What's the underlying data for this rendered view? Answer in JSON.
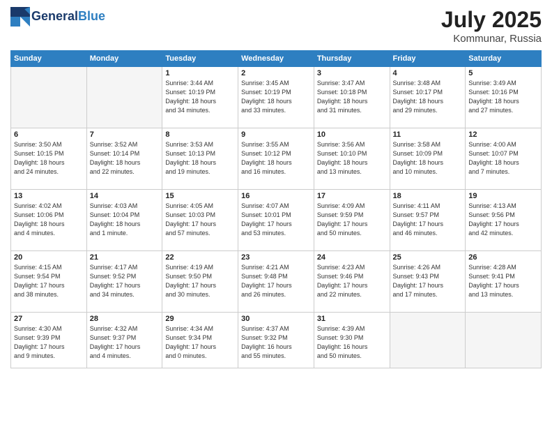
{
  "header": {
    "logo_line1": "General",
    "logo_line2": "Blue",
    "month": "July 2025",
    "location": "Kommunar, Russia"
  },
  "weekdays": [
    "Sunday",
    "Monday",
    "Tuesday",
    "Wednesday",
    "Thursday",
    "Friday",
    "Saturday"
  ],
  "weeks": [
    [
      {
        "day": "",
        "info": ""
      },
      {
        "day": "",
        "info": ""
      },
      {
        "day": "1",
        "info": "Sunrise: 3:44 AM\nSunset: 10:19 PM\nDaylight: 18 hours\nand 34 minutes."
      },
      {
        "day": "2",
        "info": "Sunrise: 3:45 AM\nSunset: 10:19 PM\nDaylight: 18 hours\nand 33 minutes."
      },
      {
        "day": "3",
        "info": "Sunrise: 3:47 AM\nSunset: 10:18 PM\nDaylight: 18 hours\nand 31 minutes."
      },
      {
        "day": "4",
        "info": "Sunrise: 3:48 AM\nSunset: 10:17 PM\nDaylight: 18 hours\nand 29 minutes."
      },
      {
        "day": "5",
        "info": "Sunrise: 3:49 AM\nSunset: 10:16 PM\nDaylight: 18 hours\nand 27 minutes."
      }
    ],
    [
      {
        "day": "6",
        "info": "Sunrise: 3:50 AM\nSunset: 10:15 PM\nDaylight: 18 hours\nand 24 minutes."
      },
      {
        "day": "7",
        "info": "Sunrise: 3:52 AM\nSunset: 10:14 PM\nDaylight: 18 hours\nand 22 minutes."
      },
      {
        "day": "8",
        "info": "Sunrise: 3:53 AM\nSunset: 10:13 PM\nDaylight: 18 hours\nand 19 minutes."
      },
      {
        "day": "9",
        "info": "Sunrise: 3:55 AM\nSunset: 10:12 PM\nDaylight: 18 hours\nand 16 minutes."
      },
      {
        "day": "10",
        "info": "Sunrise: 3:56 AM\nSunset: 10:10 PM\nDaylight: 18 hours\nand 13 minutes."
      },
      {
        "day": "11",
        "info": "Sunrise: 3:58 AM\nSunset: 10:09 PM\nDaylight: 18 hours\nand 10 minutes."
      },
      {
        "day": "12",
        "info": "Sunrise: 4:00 AM\nSunset: 10:07 PM\nDaylight: 18 hours\nand 7 minutes."
      }
    ],
    [
      {
        "day": "13",
        "info": "Sunrise: 4:02 AM\nSunset: 10:06 PM\nDaylight: 18 hours\nand 4 minutes."
      },
      {
        "day": "14",
        "info": "Sunrise: 4:03 AM\nSunset: 10:04 PM\nDaylight: 18 hours\nand 1 minute."
      },
      {
        "day": "15",
        "info": "Sunrise: 4:05 AM\nSunset: 10:03 PM\nDaylight: 17 hours\nand 57 minutes."
      },
      {
        "day": "16",
        "info": "Sunrise: 4:07 AM\nSunset: 10:01 PM\nDaylight: 17 hours\nand 53 minutes."
      },
      {
        "day": "17",
        "info": "Sunrise: 4:09 AM\nSunset: 9:59 PM\nDaylight: 17 hours\nand 50 minutes."
      },
      {
        "day": "18",
        "info": "Sunrise: 4:11 AM\nSunset: 9:57 PM\nDaylight: 17 hours\nand 46 minutes."
      },
      {
        "day": "19",
        "info": "Sunrise: 4:13 AM\nSunset: 9:56 PM\nDaylight: 17 hours\nand 42 minutes."
      }
    ],
    [
      {
        "day": "20",
        "info": "Sunrise: 4:15 AM\nSunset: 9:54 PM\nDaylight: 17 hours\nand 38 minutes."
      },
      {
        "day": "21",
        "info": "Sunrise: 4:17 AM\nSunset: 9:52 PM\nDaylight: 17 hours\nand 34 minutes."
      },
      {
        "day": "22",
        "info": "Sunrise: 4:19 AM\nSunset: 9:50 PM\nDaylight: 17 hours\nand 30 minutes."
      },
      {
        "day": "23",
        "info": "Sunrise: 4:21 AM\nSunset: 9:48 PM\nDaylight: 17 hours\nand 26 minutes."
      },
      {
        "day": "24",
        "info": "Sunrise: 4:23 AM\nSunset: 9:46 PM\nDaylight: 17 hours\nand 22 minutes."
      },
      {
        "day": "25",
        "info": "Sunrise: 4:26 AM\nSunset: 9:43 PM\nDaylight: 17 hours\nand 17 minutes."
      },
      {
        "day": "26",
        "info": "Sunrise: 4:28 AM\nSunset: 9:41 PM\nDaylight: 17 hours\nand 13 minutes."
      }
    ],
    [
      {
        "day": "27",
        "info": "Sunrise: 4:30 AM\nSunset: 9:39 PM\nDaylight: 17 hours\nand 9 minutes."
      },
      {
        "day": "28",
        "info": "Sunrise: 4:32 AM\nSunset: 9:37 PM\nDaylight: 17 hours\nand 4 minutes."
      },
      {
        "day": "29",
        "info": "Sunrise: 4:34 AM\nSunset: 9:34 PM\nDaylight: 17 hours\nand 0 minutes."
      },
      {
        "day": "30",
        "info": "Sunrise: 4:37 AM\nSunset: 9:32 PM\nDaylight: 16 hours\nand 55 minutes."
      },
      {
        "day": "31",
        "info": "Sunrise: 4:39 AM\nSunset: 9:30 PM\nDaylight: 16 hours\nand 50 minutes."
      },
      {
        "day": "",
        "info": ""
      },
      {
        "day": "",
        "info": ""
      }
    ]
  ]
}
